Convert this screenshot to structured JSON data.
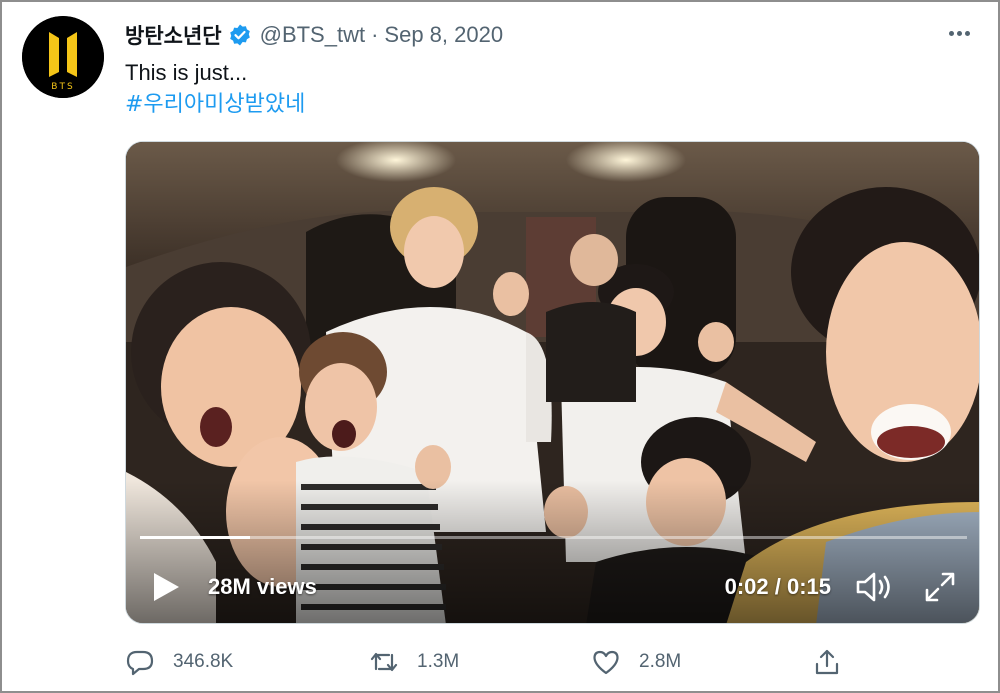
{
  "tweet": {
    "display_name": "방탄소년단",
    "handle": "@BTS_twt",
    "separator": "·",
    "date": "Sep 8, 2020",
    "text": "This is just...",
    "hashtag": "#우리아미상받았네",
    "avatar_text": "BTS",
    "verified_color": "#1d9bf0"
  },
  "video": {
    "views": "28M views",
    "time_display": "0:02 / 0:15",
    "progress": 0.133
  },
  "actions": {
    "replies": "346.8K",
    "retweets": "1.3M",
    "likes": "2.8M"
  },
  "colors": {
    "link": "#1d9bf0",
    "secondary_text": "#536471",
    "avatar_gold": "#f5c518"
  }
}
